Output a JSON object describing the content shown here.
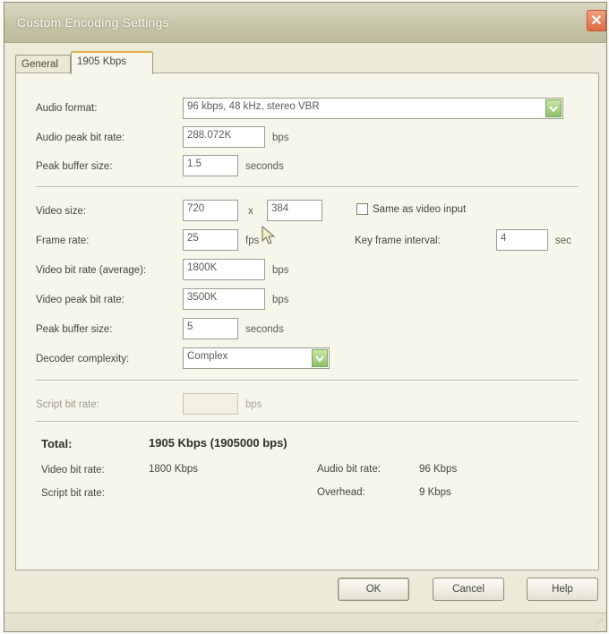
{
  "window": {
    "title": "Custom Encoding Settings",
    "close_glyph": "✕"
  },
  "tabs": [
    {
      "label": "General"
    },
    {
      "label": "1905 Kbps",
      "active": true
    }
  ],
  "audio": {
    "format_label": "Audio format:",
    "format_value": "96 kbps, 48 kHz, stereo VBR",
    "peak_bit_rate_label": "Audio peak bit rate:",
    "peak_bit_rate_value": "288.072K",
    "peak_bit_rate_unit": "bps",
    "peak_buffer_label": "Peak buffer size:",
    "peak_buffer_value": "1.5",
    "peak_buffer_unit": "seconds"
  },
  "video": {
    "size_label": "Video size:",
    "width_value": "720",
    "size_sep": "x",
    "height_value": "384",
    "same_as_input_label": "Same as video input",
    "frame_rate_label": "Frame rate:",
    "frame_rate_value": "25",
    "frame_rate_unit": "fps",
    "key_frame_label": "Key frame interval:",
    "key_frame_value": "4",
    "key_frame_unit": "sec",
    "bit_rate_avg_label": "Video bit rate (average):",
    "bit_rate_avg_value": "1800K",
    "bit_rate_avg_unit": "bps",
    "peak_bit_rate_label": "Video peak bit rate:",
    "peak_bit_rate_value": "3500K",
    "peak_bit_rate_unit": "bps",
    "peak_buffer_label": "Peak buffer size:",
    "peak_buffer_value": "5",
    "peak_buffer_unit": "seconds",
    "decoder_label": "Decoder complexity:",
    "decoder_value": "Complex"
  },
  "script": {
    "bit_rate_label": "Script bit rate:",
    "bit_rate_value": "",
    "bit_rate_unit": "bps"
  },
  "summary": {
    "total_label": "Total:",
    "total_value": "1905 Kbps (1905000 bps)",
    "video_bit_rate_label": "Video bit rate:",
    "video_bit_rate_value": "1800 Kbps",
    "audio_bit_rate_label": "Audio bit rate:",
    "audio_bit_rate_value": "96 Kbps",
    "script_bit_rate_label": "Script bit rate:",
    "script_bit_rate_value": "",
    "overhead_label": "Overhead:",
    "overhead_value": "9 Kbps"
  },
  "buttons": {
    "ok": "OK",
    "cancel": "Cancel",
    "help": "Help"
  },
  "colors": {
    "accent_tab": "#e3b24e",
    "close": "#df6a43",
    "dropdown_arrow": "#8fc06a"
  }
}
